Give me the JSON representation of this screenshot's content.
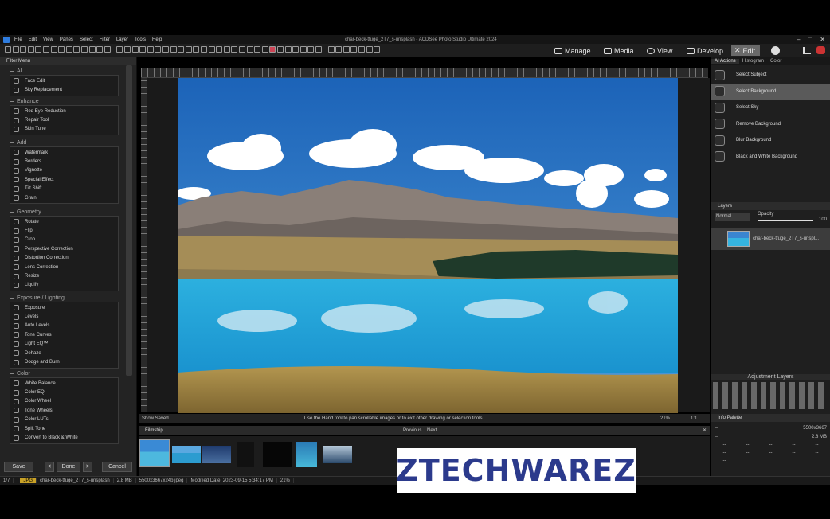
{
  "window": {
    "title": "char-beck-tfuge_2T7_s-unsplash - ACDSee Photo Studio Ultimate 2024",
    "menu": [
      "File",
      "Edit",
      "View",
      "Panes",
      "Select",
      "Filter",
      "Layer",
      "Tools",
      "Help"
    ]
  },
  "modes": {
    "manage": "Manage",
    "media": "Media",
    "view": "View",
    "develop": "Develop",
    "edit": "Edit"
  },
  "filter_menu": {
    "title": "Filter Menu",
    "sections": [
      {
        "title": "AI",
        "items": [
          "Face Edit",
          "Sky Replacement"
        ]
      },
      {
        "title": "Enhance",
        "items": [
          "Red Eye Reduction",
          "Repair Tool",
          "Skin Tune"
        ]
      },
      {
        "title": "Add",
        "items": [
          "Watermark",
          "Borders",
          "Vignette",
          "Special Effect",
          "Tilt Shift",
          "Grain"
        ]
      },
      {
        "title": "Geometry",
        "items": [
          "Rotate",
          "Flip",
          "Crop",
          "Perspective Correction",
          "Distortion Correction",
          "Lens Correction",
          "Resize",
          "Liquify"
        ]
      },
      {
        "title": "Exposure / Lighting",
        "items": [
          "Exposure",
          "Levels",
          "Auto Levels",
          "Tone Curves",
          "Light EQ™",
          "Dehaze",
          "Dodge and Burn"
        ]
      },
      {
        "title": "Color",
        "items": [
          "White Balance",
          "Color EQ",
          "Color Wheel",
          "Tone Wheels",
          "Color LUTs",
          "Split Tone",
          "Convert to Black & White"
        ]
      }
    ]
  },
  "buttons": {
    "save": "Save",
    "done": "Done",
    "cancel": "Cancel",
    "prev": "<",
    "next": ">"
  },
  "status": {
    "show_saved": "Show Saved",
    "hint": "Use the Hand tool to pan scrollable images or to exit other drawing or selection tools.",
    "zoom": "21%",
    "ratio": "1:1"
  },
  "filmstrip": {
    "title": "Filmstrip",
    "previous": "Previous",
    "next": "Next"
  },
  "right": {
    "tabs": [
      "AI Actions",
      "Histogram",
      "Color"
    ],
    "ai_actions": [
      "Select Subject",
      "Select Background",
      "Select Sky",
      "Remove Background",
      "Blur Background",
      "Black and White Background"
    ],
    "selected_index": 1,
    "layers_title": "Layers",
    "blend": "Normal",
    "opacity_label": "Opacity",
    "opacity_value": "100",
    "opacity_fraction": 1.0,
    "layer_name": "char-beck-tfuge_2T7_s-unspl...",
    "adjustment_layers": "Adjustment Layers",
    "info_palette": "Info Palette",
    "info": {
      "row1_left": "--",
      "row1_right": "5500x3667",
      "row2_left": "--",
      "row2_right": "2.8 MB",
      "cells": [
        "--",
        "--",
        "--",
        "--",
        "--",
        "--",
        "--",
        "--",
        "--",
        "--",
        "--"
      ]
    }
  },
  "bottom": {
    "count": "1/7",
    "type": "JPG",
    "filename": "char-beck-tfuge_2T7_s-unsplash",
    "size": "2.8 MB",
    "dims": "5500x3667x24b.jpeg",
    "modified": "Modified Date: 2023-09-15 5:34:17 PM",
    "zoom": "21%"
  },
  "watermark": {
    "text": "ZTECHWAREZ"
  }
}
